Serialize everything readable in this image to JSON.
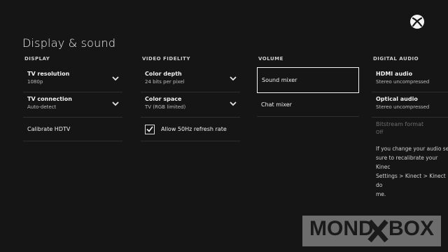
{
  "page_title": "Display & sound",
  "logo_icon": "xbox-logo-icon",
  "display": {
    "heading": "DISPLAY",
    "tv_resolution": {
      "label": "TV resolution",
      "value": "1080p"
    },
    "tv_connection": {
      "label": "TV connection",
      "value": "Auto-detect"
    },
    "calibrate": {
      "label": "Calibrate HDTV"
    }
  },
  "video_fidelity": {
    "heading": "VIDEO FIDELITY",
    "color_depth": {
      "label": "Color depth",
      "value": "24 bits per pixel"
    },
    "color_space": {
      "label": "Color space",
      "value": "TV (RGB limited)"
    },
    "allow_50hz": {
      "label": "Allow 50Hz refresh rate",
      "checked": true
    }
  },
  "volume": {
    "heading": "VOLUME",
    "sound_mixer": {
      "label": "Sound mixer"
    },
    "chat_mixer": {
      "label": "Chat mixer"
    }
  },
  "digital_audio": {
    "heading": "DIGITAL AUDIO",
    "hdmi_audio": {
      "label": "HDMI audio",
      "value": "Stereo uncompressed"
    },
    "optical_audio": {
      "label": "Optical audio",
      "value": "Stereo uncompressed"
    },
    "bitstream_format": {
      "label": "Bitstream format",
      "value": "Off"
    },
    "note": "If you change your audio set\nsure to recalibrate your Kinec\nSettings > Kinect > Kinect do\nme."
  },
  "watermark": {
    "left": "MOND",
    "right": "BOX"
  },
  "colors": {
    "background": "#151515",
    "focus_border": "#f2f2f2",
    "watermark": "#7d7d7d"
  }
}
